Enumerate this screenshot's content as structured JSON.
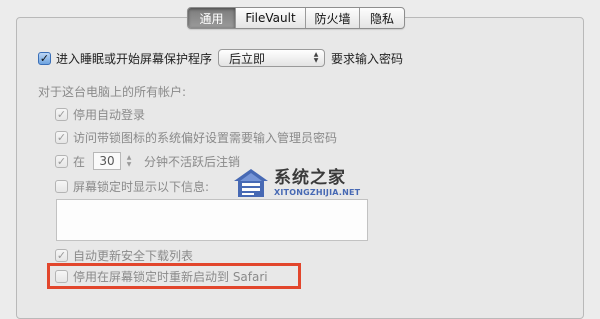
{
  "tabs": [
    {
      "label": "通用",
      "active": true
    },
    {
      "label": "FileVault",
      "active": false
    },
    {
      "label": "防火墙",
      "active": false
    },
    {
      "label": "隐私",
      "active": false
    }
  ],
  "sleep_password": {
    "checked": true,
    "label": "进入睡眠或开始屏幕保护程序",
    "select_value": "后立即",
    "suffix": "要求输入密码"
  },
  "all_accounts_heading": "对于这台电脑上的所有帐户:",
  "options": {
    "disable_autologin": {
      "checked": true,
      "label": "停用自动登录"
    },
    "require_admin_password": {
      "checked": true,
      "label": "访问带锁图标的系统偏好设置需要输入管理员密码"
    },
    "logout_after": {
      "checked": true,
      "prefix": "在",
      "minutes": "30",
      "suffix": "分钟不活跃后注销"
    },
    "show_message": {
      "checked": false,
      "label": "屏幕锁定时显示以下信息:"
    },
    "auto_update_security": {
      "checked": true,
      "label": "自动更新安全下载列表"
    },
    "disable_safari_relaunch": {
      "checked": false,
      "label": "停用在屏幕锁定时重新启动到 Safari"
    }
  },
  "watermark": {
    "name_cn": "系统之家",
    "name_en": "XITONGZHIJIA.NET"
  },
  "colors": {
    "highlight": "#e2462c",
    "active_tab": "#8a8a8a",
    "watermark_blue": "#3a5fb0"
  },
  "icons": {
    "checkmark": "✓",
    "select_arrows": "updown-arrows",
    "stepper": "stepper-arrows"
  }
}
